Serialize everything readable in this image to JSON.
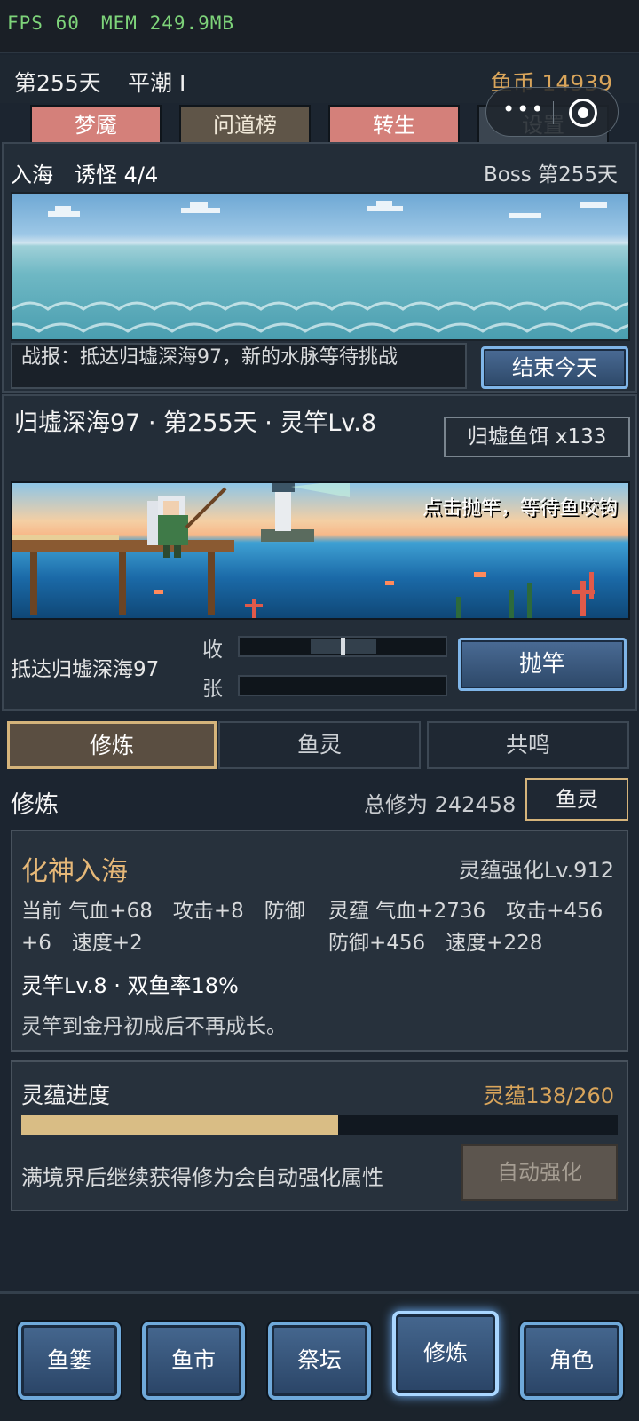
{
  "debug": {
    "fps": "FPS 60",
    "mem": "MEM 249.9MB"
  },
  "status": {
    "day": "第255天",
    "tide": "平潮 I",
    "coins": "鱼币 14939"
  },
  "capsule": {
    "dots": "•••"
  },
  "top_tabs": [
    "梦魇",
    "问道榜",
    "转生",
    "设置"
  ],
  "sea": {
    "title": "入海　诱怪 4/4",
    "boss": "Boss 第255天",
    "report": "战报：抵达归墟深海97，新的水脉等待挑战",
    "end_day": "结束今天"
  },
  "fishing": {
    "spot": "归墟深海97 · 第255天 · 灵竿Lv.8",
    "bait": "归墟鱼饵 x133",
    "hint": "点击抛竿，等待鱼咬钩",
    "arrived": "抵达归墟深海97",
    "reel_label": "收",
    "tension_label": "张",
    "cast": "抛竿"
  },
  "sub_tabs": [
    "修炼",
    "鱼灵",
    "共鸣"
  ],
  "cultivation": {
    "heading": "修炼",
    "total": "总修为 242458",
    "yuling_btn": "鱼灵",
    "realm": "化神入海",
    "realm_level": "灵蕴强化Lv.912",
    "current_attrs": "当前 气血+68　攻击+8　防御+6　速度+2",
    "lingyun_attrs": "灵蕴 气血+2736　攻击+456　防御+456　速度+228",
    "rod_line": "灵竿Lv.8 · 双鱼率18%",
    "rod_note": "灵竿到金丹初成后不再成长。"
  },
  "progress": {
    "title": "灵蕴进度",
    "count": "灵蕴138/260",
    "current": 138,
    "max": 260,
    "note": "满境界后继续获得修为会自动强化属性",
    "auto_btn": "自动强化"
  },
  "bottom_nav": [
    "鱼篓",
    "鱼市",
    "祭坛",
    "修炼",
    "角色"
  ],
  "colors": {
    "gold": "#d9a55b",
    "accent_blue": "#7fb5e8",
    "tab_red": "#d4807a"
  }
}
